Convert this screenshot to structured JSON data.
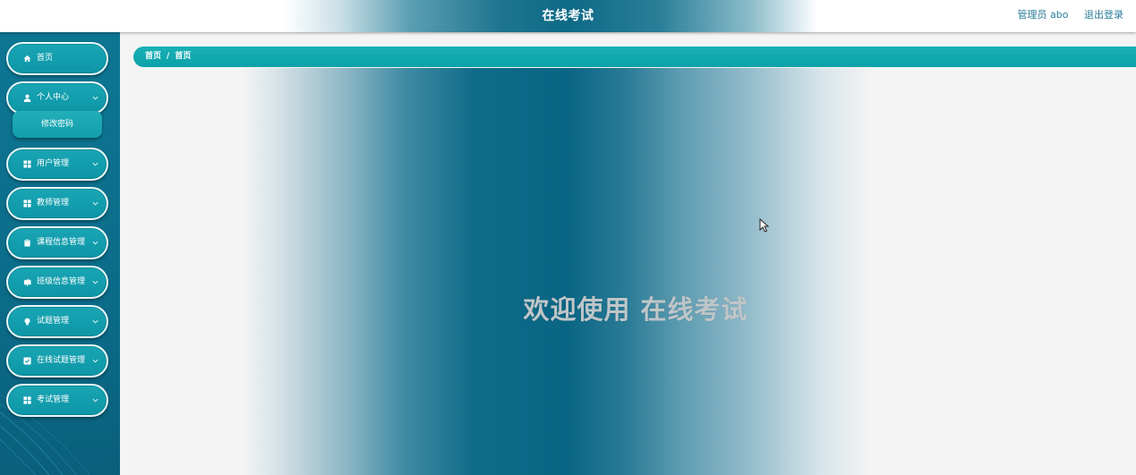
{
  "app": {
    "title": "在线考试"
  },
  "header": {
    "user_label": "管理员 abo",
    "logout_label": "退出登录"
  },
  "sidebar": {
    "items": [
      {
        "label": "首页",
        "icon": "home-icon"
      },
      {
        "label": "个人中心",
        "icon": "user-icon",
        "expandable": true
      },
      {
        "label": "用户管理",
        "icon": "grid-icon",
        "expandable": true
      },
      {
        "label": "教师管理",
        "icon": "grid-icon",
        "expandable": true
      },
      {
        "label": "课程信息管理",
        "icon": "clipboard-icon",
        "expandable": true
      },
      {
        "label": "班级信息管理",
        "icon": "mailbox-icon",
        "expandable": true
      },
      {
        "label": "试题管理",
        "icon": "bulb-icon",
        "expandable": true
      },
      {
        "label": "在线试题管理",
        "icon": "check-square-icon",
        "expandable": true
      },
      {
        "label": "考试管理",
        "icon": "grid-icon",
        "expandable": true
      }
    ],
    "submenu": {
      "parent": "个人中心",
      "items": [
        {
          "label": "修改密码"
        }
      ]
    }
  },
  "breadcrumb": {
    "items": [
      "首页",
      "首页"
    ],
    "separator": "/"
  },
  "main": {
    "welcome": "欢迎使用 在线考试"
  },
  "colors": {
    "sidebar": "#0b6c89",
    "menu_button": "#0c96a6",
    "breadcrumb": "#0aa1a8",
    "header_link": "#2a7d97"
  }
}
